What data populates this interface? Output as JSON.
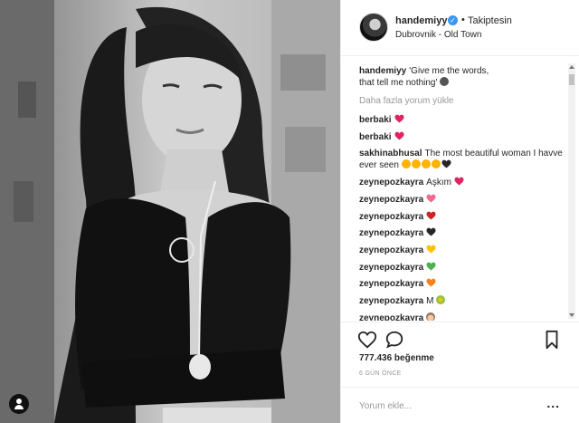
{
  "post": {
    "username": "handemiyy",
    "verified_icon": "verified-badge-icon",
    "separator": "•",
    "follow_status": "Takiptesin",
    "location": "Dubrovnik - Old Town",
    "caption_line1": "'Give me the words,",
    "caption_line2": "that tell me nothing'",
    "caption_emoji": "neutral-face-emoji",
    "load_more": "Daha fazla yorum yükle",
    "likes": "777.436 beğenme",
    "time_ago": "6 GÜN ÖNCE",
    "comment_placeholder": "Yorum ekle...",
    "more_options": "..."
  },
  "comments": [
    {
      "user": "berbaki",
      "text": "",
      "emoji": [
        "red-heart"
      ]
    },
    {
      "user": "berbaki",
      "text": "",
      "emoji": [
        "red-heart"
      ]
    },
    {
      "user": "sakhinabhusal",
      "text": "The most beautiful woman I havve ever seen",
      "emoji": [
        "heart-eyes",
        "heart-eyes",
        "heart-eyes",
        "heart-eyes",
        "black-heart"
      ]
    },
    {
      "user": "zeynepozkayra",
      "text": "Aşkım",
      "emoji": [
        "red-heart"
      ]
    },
    {
      "user": "zeynepozkayra",
      "text": "",
      "emoji": [
        "growing-heart"
      ]
    },
    {
      "user": "zeynepozkayra",
      "text": "",
      "emoji": [
        "broken-heart"
      ]
    },
    {
      "user": "zeynepozkayra",
      "text": "",
      "emoji": [
        "black-heart"
      ]
    },
    {
      "user": "zeynepozkayra",
      "text": "",
      "emoji": [
        "yellow-heart"
      ]
    },
    {
      "user": "zeynepozkayra",
      "text": "",
      "emoji": [
        "green-heart"
      ]
    },
    {
      "user": "zeynepozkayra",
      "text": "",
      "emoji": [
        "orange-heart"
      ]
    },
    {
      "user": "zeynepozkayra",
      "text": "M",
      "emoji": [
        "bouquet"
      ]
    },
    {
      "user": "zeynepozkayra",
      "text": "",
      "emoji": [
        "woman-face"
      ]
    }
  ],
  "colors": {
    "red-heart": "#e0245e",
    "growing-heart": "#f26a8d",
    "broken-heart": "#c62828",
    "black-heart": "#262626",
    "yellow-heart": "#ffc107",
    "green-heart": "#4caf50",
    "orange-heart": "#f5821f",
    "heart-eyes": "#ffb300",
    "verified": "#3897f0"
  },
  "icons": {
    "like": "heart-outline-icon",
    "comment": "speech-bubble-icon",
    "save": "bookmark-icon",
    "tag": "user-tag-icon"
  }
}
